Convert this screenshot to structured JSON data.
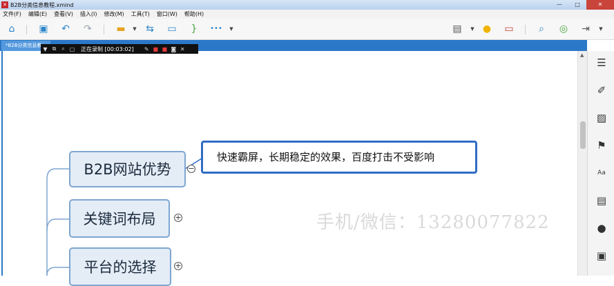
{
  "window": {
    "title": "B2B分类信息教程.xmind",
    "app_icon": "xmind-logo-icon",
    "controls": {
      "minimize": "—",
      "maximize": "□",
      "close": "✕"
    }
  },
  "menu": [
    "文件(F)",
    "编辑(E)",
    "查看(V)",
    "插入(I)",
    "修改(M)",
    "工具(T)",
    "窗口(W)",
    "帮助(H)"
  ],
  "toolbar": {
    "icons": [
      "home-icon",
      "save-icon",
      "undo-icon",
      "redo-icon",
      "topic-icon",
      "relationship-icon",
      "boundary-icon",
      "summary-icon",
      "more-icon",
      "presentation-icon",
      "idea-icon",
      "layout-icon",
      "search-icon",
      "share-icon",
      "export-icon"
    ],
    "more_label": "•••"
  },
  "tabs": [
    {
      "label": "*B2B分类信息教..."
    }
  ],
  "recorder": {
    "status": "正在录制 [00:03:02]"
  },
  "mindmap": {
    "topics": [
      {
        "label": "B2B网站优势",
        "state": "expanded",
        "toggle": "−"
      },
      {
        "label": "关键词布局",
        "state": "collapsed",
        "toggle": "+"
      },
      {
        "label": "平台的选择",
        "state": "collapsed",
        "toggle": "+"
      }
    ],
    "callout": "快速霸屏，长期稳定的效果，百度打击不受影响",
    "accent_color": "#2f6cc4",
    "node_fill": "#e4ecf6",
    "node_border": "#7ea6d1"
  },
  "watermark": "手机/微信：13280077822",
  "right_panel_icons": [
    "outline-icon",
    "style-icon",
    "image-icon",
    "flag-icon",
    "text-format-icon",
    "notes-icon",
    "comment-icon",
    "task-icon"
  ]
}
